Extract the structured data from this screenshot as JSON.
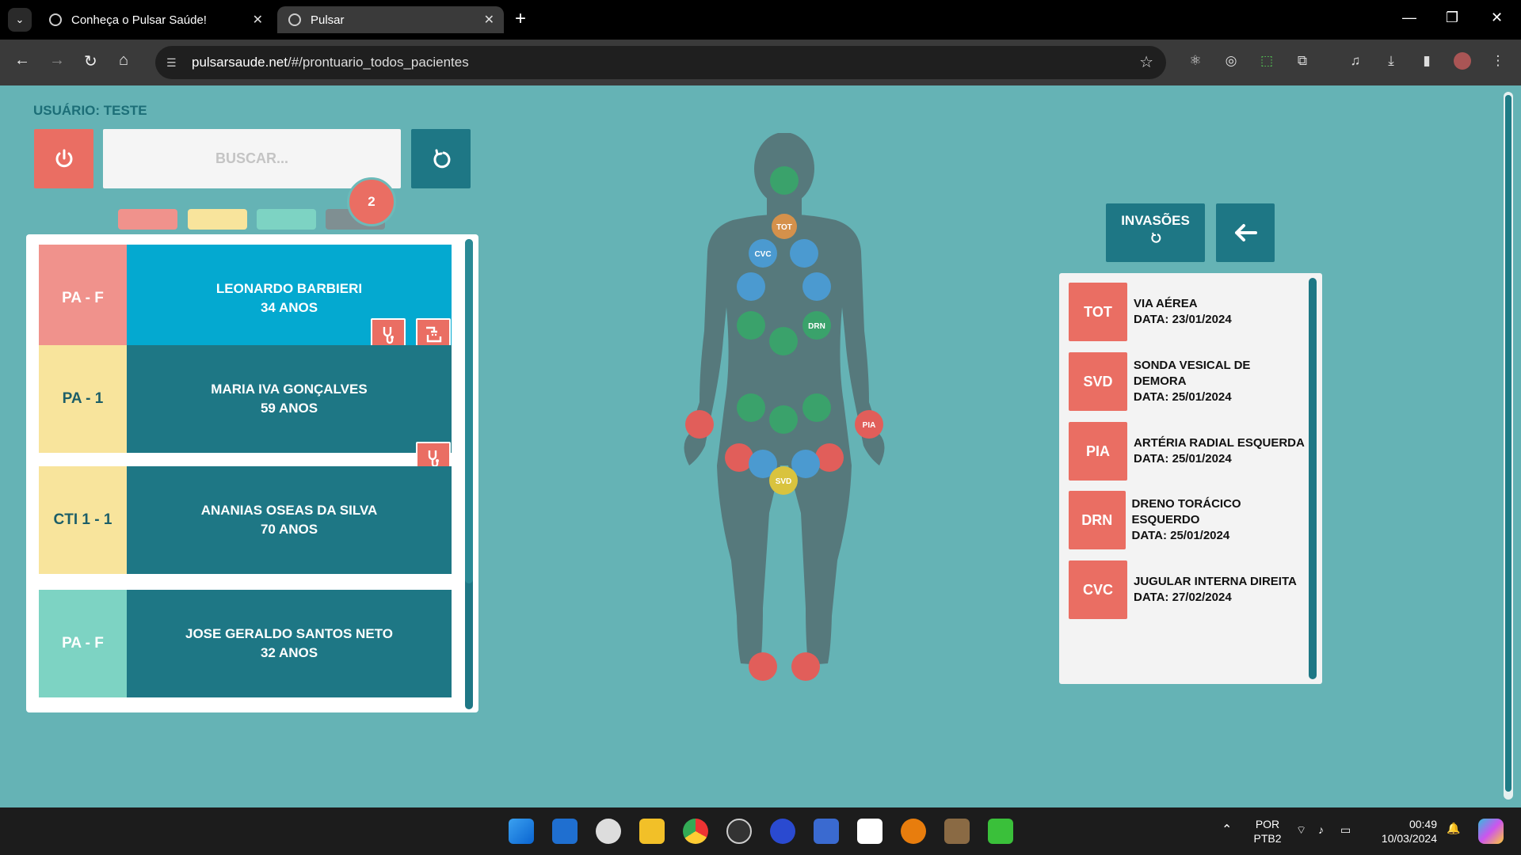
{
  "browser": {
    "tabs": [
      {
        "title": "Conheça o Pulsar Saúde!",
        "close": "✕"
      },
      {
        "title": "Pulsar",
        "close": "✕"
      }
    ],
    "url_domain": "pulsarsaude.net",
    "url_path": "/#/prontuario_todos_pacientes"
  },
  "header": {
    "user_label": "USUÁRIO: TESTE",
    "search_placeholder": "BUSCAR...",
    "notification_count": "2"
  },
  "filters": [
    {
      "color": "#f0928c"
    },
    {
      "color": "#f8e49c"
    },
    {
      "color": "#7dd3c3"
    },
    {
      "color": "#7f8f92"
    }
  ],
  "patients": [
    {
      "location": "PA - F",
      "name": "LEONARDO BARBIERI",
      "age": "34 ANOS",
      "loc_color": "#f0928c",
      "info_color": "#04a9d0"
    },
    {
      "location": "PA - 1",
      "name": "MARIA IVA GONÇALVES",
      "age": "59 ANOS",
      "loc_color": "#f8e49c",
      "info_color": "#1e7785"
    },
    {
      "location": "CTI 1 - 1",
      "name": "ANANIAS OSEAS DA SILVA",
      "age": "70 ANOS",
      "loc_color": "#f8e49c",
      "info_color": "#1e7785"
    },
    {
      "location": "PA - F",
      "name": "JOSE GERALDO SANTOS NETO",
      "age": "32 ANOS",
      "loc_color": "#7dd3c3",
      "info_color": "#1e7785"
    }
  ],
  "body_markers": {
    "tot": "TOT",
    "cvc": "CVC",
    "drn": "DRN",
    "pia": "PIA",
    "svd": "SVD"
  },
  "invasions": {
    "title": "INVASÕES",
    "items": [
      {
        "code": "TOT",
        "desc": "VIA AÉREA",
        "date": "DATA: 23/01/2024"
      },
      {
        "code": "SVD",
        "desc": "SONDA VESICAL DE DEMORA",
        "date": "DATA: 25/01/2024"
      },
      {
        "code": "PIA",
        "desc": "ARTÉRIA RADIAL ESQUERDA",
        "date": "DATA: 25/01/2024"
      },
      {
        "code": "DRN",
        "desc": "DRENO TORÁCICO ESQUERDO",
        "date": "DATA: 25/01/2024"
      },
      {
        "code": "CVC",
        "desc": "JUGULAR INTERNA DIREITA",
        "date": "DATA: 27/02/2024"
      }
    ]
  },
  "taskbar": {
    "lang": "POR",
    "layout": "PTB2",
    "time": "00:49",
    "date": "10/03/2024"
  },
  "colors": {
    "background": "#65b3b5",
    "accent": "#1e7785",
    "alert": "#ea6e63",
    "marker_green": "#3aa26b",
    "marker_blue": "#4b9ad0",
    "marker_red": "#e15e5a",
    "marker_orange": "#d5914b",
    "marker_yellow": "#d9c33e"
  }
}
